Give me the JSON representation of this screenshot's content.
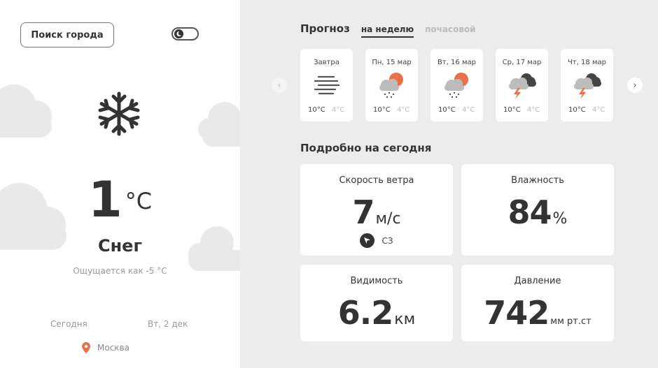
{
  "search": {
    "label": "Поиск города"
  },
  "current": {
    "temp": "1",
    "unit": "°C",
    "condition": "Снег",
    "feels_like": "Ощущается как -5 °C",
    "today_label": "Сегодня",
    "date": "Вт, 2 дек",
    "location": "Москва",
    "icon": "snowflake-icon"
  },
  "forecast": {
    "title": "Прогноз",
    "tabs": [
      "на неделю",
      "почасовой"
    ],
    "active_tab": "на неделю",
    "days": [
      {
        "label": "Завтра",
        "hi": "10°C",
        "lo": "4°C",
        "icon": "fog-icon"
      },
      {
        "label": "Пн, 15 мар",
        "hi": "10°C",
        "lo": "4°C",
        "icon": "sun-rain-icon"
      },
      {
        "label": "Вт, 16 мар",
        "hi": "10°C",
        "lo": "4°C",
        "icon": "sun-rain-icon"
      },
      {
        "label": "Ср, 17 мар",
        "hi": "10°C",
        "lo": "4°C",
        "icon": "thunderstorm-icon"
      },
      {
        "label": "Чт, 18 мар",
        "hi": "10°C",
        "lo": "4°C",
        "icon": "thunderstorm-icon"
      }
    ]
  },
  "details": {
    "title": "Подробно на сегодня",
    "wind": {
      "label": "Скорость ветра",
      "value": "7",
      "unit": "м/с",
      "direction": "СЗ"
    },
    "humidity": {
      "label": "Влажность",
      "value": "84",
      "unit": "%"
    },
    "visibility": {
      "label": "Видимость",
      "value": "6.2",
      "unit": "км"
    },
    "pressure": {
      "label": "Давление",
      "value": "742",
      "unit": "мм рт.ст"
    }
  },
  "colors": {
    "accent": "#e8714a",
    "text": "#333333",
    "muted": "#999999",
    "background": "#ececec"
  }
}
